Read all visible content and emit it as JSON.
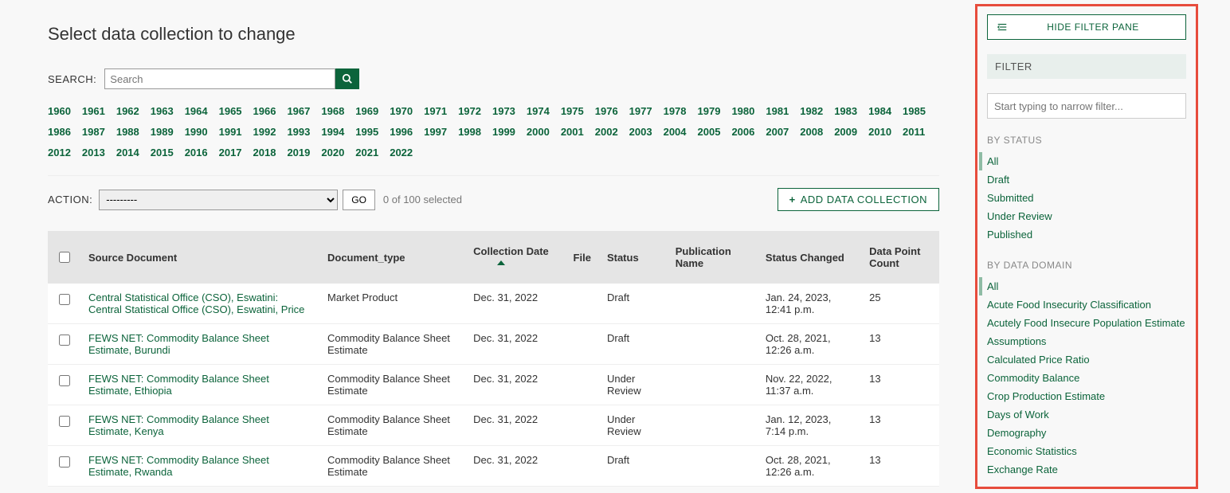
{
  "page_title": "Select data collection to change",
  "search": {
    "label": "SEARCH:",
    "placeholder": "Search"
  },
  "years": [
    "1960",
    "1961",
    "1962",
    "1963",
    "1964",
    "1965",
    "1966",
    "1967",
    "1968",
    "1969",
    "1970",
    "1971",
    "1972",
    "1973",
    "1974",
    "1975",
    "1976",
    "1977",
    "1978",
    "1979",
    "1980",
    "1981",
    "1982",
    "1983",
    "1984",
    "1985",
    "1986",
    "1987",
    "1988",
    "1989",
    "1990",
    "1991",
    "1992",
    "1993",
    "1994",
    "1995",
    "1996",
    "1997",
    "1998",
    "1999",
    "2000",
    "2001",
    "2002",
    "2003",
    "2004",
    "2005",
    "2006",
    "2007",
    "2008",
    "2009",
    "2010",
    "2011",
    "2012",
    "2013",
    "2014",
    "2015",
    "2016",
    "2017",
    "2018",
    "2019",
    "2020",
    "2021",
    "2022"
  ],
  "action": {
    "label": "ACTION:",
    "selected": "---------",
    "go": "GO",
    "count_text": "0 of 100 selected"
  },
  "add_button": "ADD DATA COLLECTION",
  "table": {
    "headers": {
      "source": "Source Document",
      "doc_type": "Document_type",
      "collection_date": "Collection Date",
      "file": "File",
      "status": "Status",
      "pub_name": "Publication Name",
      "status_changed": "Status Changed",
      "data_point_count": "Data Point Count"
    },
    "rows": [
      {
        "source": "Central Statistical Office (CSO), Eswatini: Central Statistical Office (CSO), Eswatini, Price",
        "doc_type": "Market Product",
        "collection_date": "Dec. 31, 2022",
        "file": "",
        "status": "Draft",
        "pub_name": "",
        "status_changed": "Jan. 24, 2023, 12:41 p.m.",
        "count": "25"
      },
      {
        "source": "FEWS NET: Commodity Balance Sheet Estimate, Burundi",
        "doc_type": "Commodity Balance Sheet Estimate",
        "collection_date": "Dec. 31, 2022",
        "file": "",
        "status": "Draft",
        "pub_name": "",
        "status_changed": "Oct. 28, 2021, 12:26 a.m.",
        "count": "13"
      },
      {
        "source": "FEWS NET: Commodity Balance Sheet Estimate, Ethiopia",
        "doc_type": "Commodity Balance Sheet Estimate",
        "collection_date": "Dec. 31, 2022",
        "file": "",
        "status": "Under Review",
        "pub_name": "",
        "status_changed": "Nov. 22, 2022, 11:37 a.m.",
        "count": "13"
      },
      {
        "source": "FEWS NET: Commodity Balance Sheet Estimate, Kenya",
        "doc_type": "Commodity Balance Sheet Estimate",
        "collection_date": "Dec. 31, 2022",
        "file": "",
        "status": "Under Review",
        "pub_name": "",
        "status_changed": "Jan. 12, 2023, 7:14 p.m.",
        "count": "13"
      },
      {
        "source": "FEWS NET: Commodity Balance Sheet Estimate, Rwanda",
        "doc_type": "Commodity Balance Sheet Estimate",
        "collection_date": "Dec. 31, 2022",
        "file": "",
        "status": "Draft",
        "pub_name": "",
        "status_changed": "Oct. 28, 2021, 12:26 a.m.",
        "count": "13"
      }
    ]
  },
  "filter_pane": {
    "hide_label": "HIDE FILTER PANE",
    "heading": "FILTER",
    "search_placeholder": "Start typing to narrow filter...",
    "groups": [
      {
        "title": "BY STATUS",
        "active": "All",
        "items": [
          "All",
          "Draft",
          "Submitted",
          "Under Review",
          "Published"
        ]
      },
      {
        "title": "BY DATA DOMAIN",
        "active": "All",
        "items": [
          "All",
          "Acute Food Insecurity Classification",
          "Acutely Food Insecure Population Estimate",
          "Assumptions",
          "Calculated Price Ratio",
          "Commodity Balance",
          "Crop Production Estimate",
          "Days of Work",
          "Demography",
          "Economic Statistics",
          "Exchange Rate"
        ]
      }
    ]
  }
}
